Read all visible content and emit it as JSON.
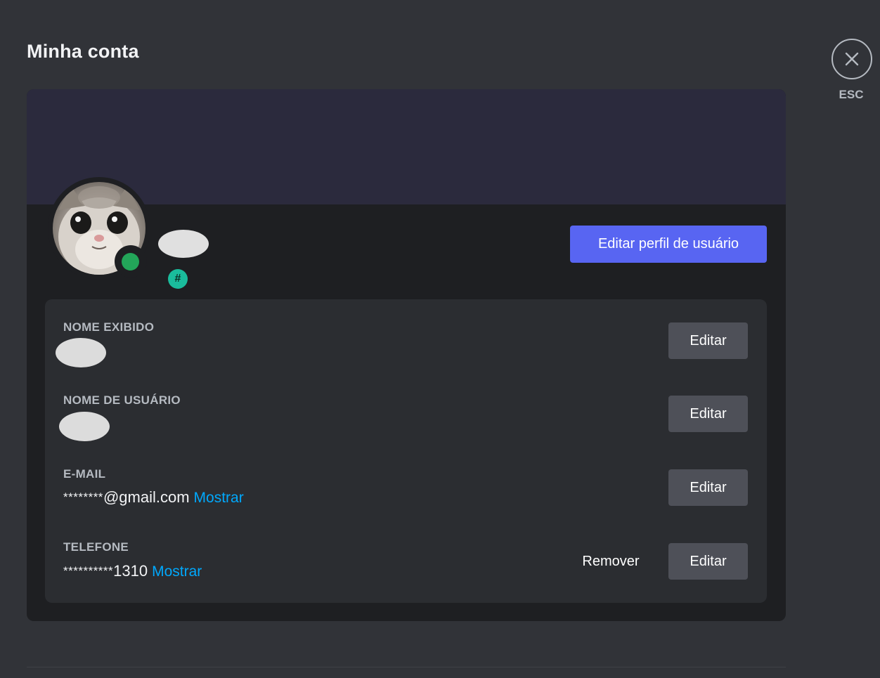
{
  "page": {
    "title": "Minha conta"
  },
  "close": {
    "icon": "close-icon",
    "label": "ESC"
  },
  "profile": {
    "banner_color": "#2b2a3d",
    "status": "online",
    "status_color": "#23a559",
    "tag_icon": "#",
    "edit_profile_label": "Editar perfil de usuário"
  },
  "fields": {
    "display_name": {
      "label": "NOME EXIBIDO",
      "edit_label": "Editar"
    },
    "username": {
      "label": "NOME DE USUÁRIO",
      "edit_label": "Editar"
    },
    "email": {
      "label": "E-MAIL",
      "masked_prefix": "********",
      "value_suffix": "@gmail.com",
      "reveal_label": "Mostrar",
      "edit_label": "Editar"
    },
    "phone": {
      "label": "TELEFONE",
      "masked_prefix": "**********",
      "value_suffix": "1310",
      "reveal_label": "Mostrar",
      "remove_label": "Remover",
      "edit_label": "Editar"
    }
  },
  "colors": {
    "accent": "#5865f2",
    "link": "#00a8fc",
    "background": "#313338"
  }
}
